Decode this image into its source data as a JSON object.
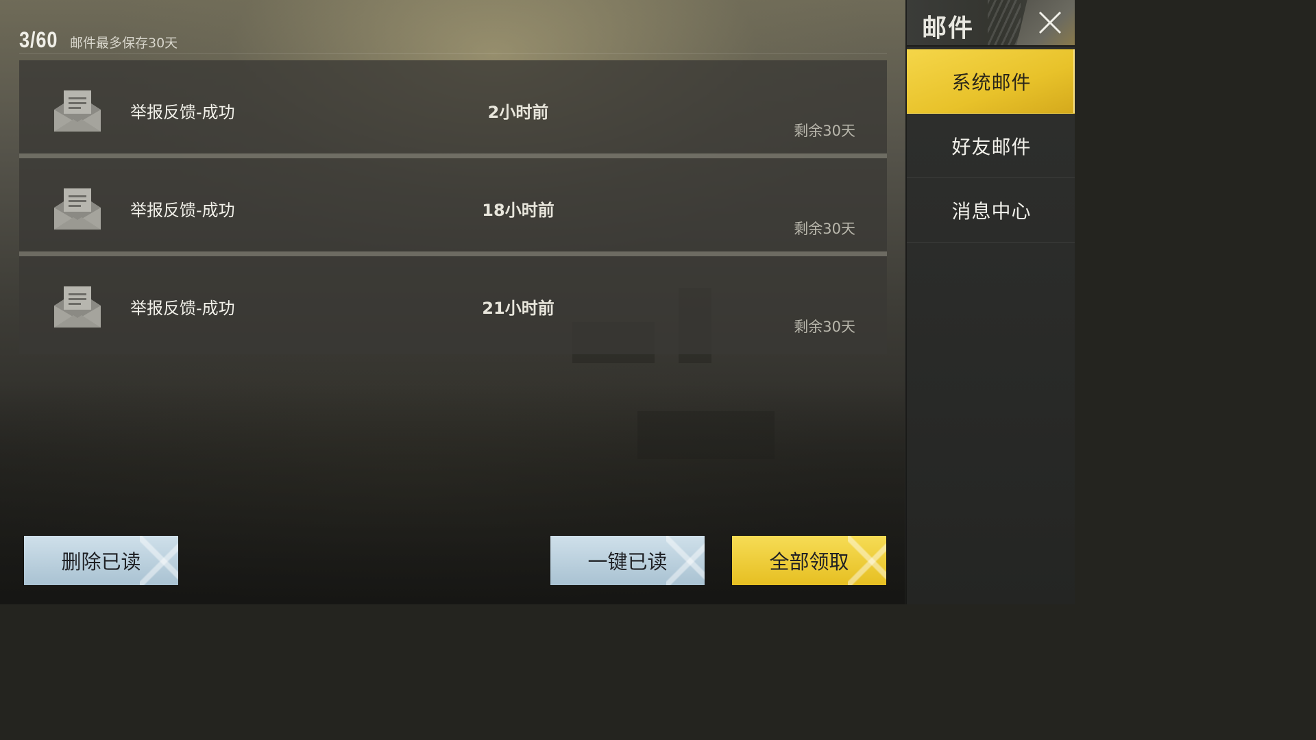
{
  "header": {
    "count": "3/60",
    "retention_note": "邮件最多保存30天"
  },
  "mails": [
    {
      "title": "举报反馈-成功",
      "time": "2小时前",
      "expiry": "剩余30天",
      "icon": "envelope-open-icon"
    },
    {
      "title": "举报反馈-成功",
      "time": "18小时前",
      "expiry": "剩余30天",
      "icon": "envelope-open-icon"
    },
    {
      "title": "举报反馈-成功",
      "time": "21小时前",
      "expiry": "剩余30天",
      "icon": "envelope-open-icon"
    }
  ],
  "actions": {
    "delete_read": "删除已读",
    "mark_all_read": "一键已读",
    "claim_all": "全部领取"
  },
  "sidebar": {
    "title": "邮件",
    "close_icon": "close-icon",
    "tabs": [
      {
        "label": "系统邮件",
        "active": true
      },
      {
        "label": "好友邮件",
        "active": false
      },
      {
        "label": "消息中心",
        "active": false
      }
    ]
  },
  "colors": {
    "accent_gold": "#f0cd3a",
    "button_blue": "#bcd3e0",
    "row_bg": "#3a3934"
  }
}
